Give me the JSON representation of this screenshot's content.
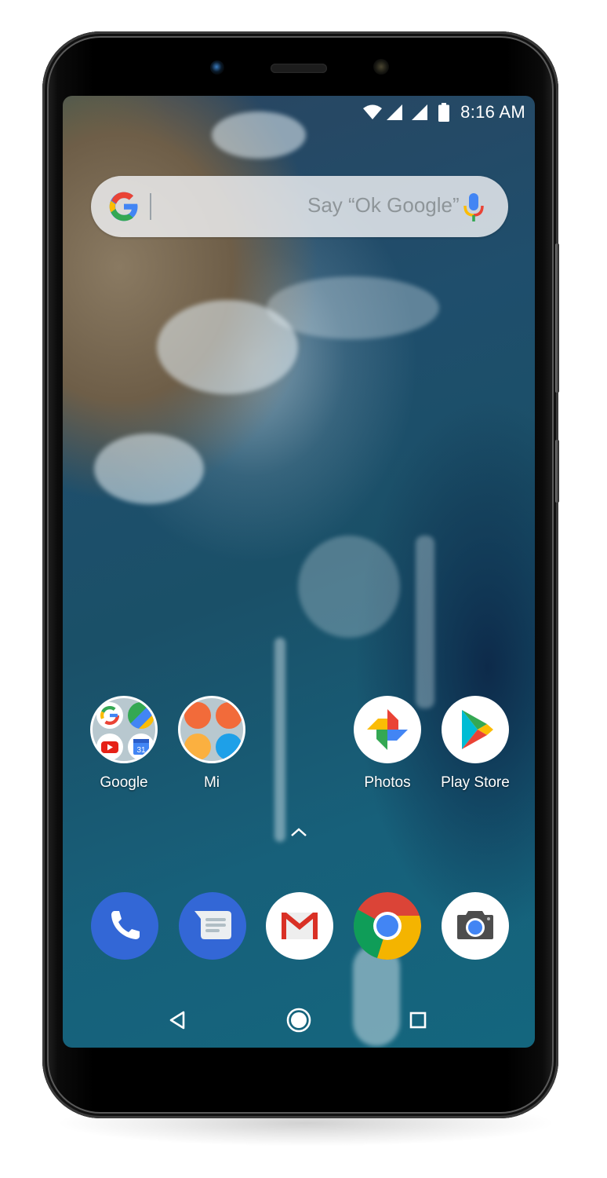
{
  "status_bar": {
    "time": "8:16 AM",
    "icons": [
      "wifi-icon",
      "signal-icon",
      "signal-icon",
      "battery-icon"
    ]
  },
  "search_widget": {
    "logo": "google-g-icon",
    "placeholder": "Say “Ok Google”",
    "mic": "microphone-icon"
  },
  "home_apps": [
    {
      "label": "Google",
      "type": "folder",
      "contents": [
        "Google",
        "Maps",
        "YouTube",
        "Calendar"
      ],
      "calendar_day": "31"
    },
    {
      "label": "Mi",
      "type": "folder",
      "contents": [
        "Mi Community",
        "Mi Store",
        "File Manager",
        "Mi Remote"
      ]
    },
    {
      "label": "Photos",
      "type": "app",
      "icon": "pinwheel-icon"
    },
    {
      "label": "Play Store",
      "type": "app",
      "icon": "play-triangle-icon"
    }
  ],
  "app_drawer": {
    "icon": "chevron-up-icon"
  },
  "dock": [
    {
      "app": "Phone",
      "icon": "phone-icon",
      "color": "#3367d6"
    },
    {
      "app": "Messages",
      "icon": "message-icon",
      "color": "#3367d6"
    },
    {
      "app": "Gmail",
      "icon": "gmail-icon",
      "color": "#d93025"
    },
    {
      "app": "Chrome",
      "icon": "chrome-icon",
      "color": "#4285f4"
    },
    {
      "app": "Camera",
      "icon": "camera-icon",
      "color": "#4285f4"
    }
  ],
  "nav_bar": {
    "back": "back-icon",
    "home": "home-icon",
    "recents": "recents-icon"
  },
  "colors": {
    "google_blue": "#4285f4",
    "google_red": "#ea4335",
    "google_yellow": "#fbbc05",
    "google_green": "#34a853"
  }
}
